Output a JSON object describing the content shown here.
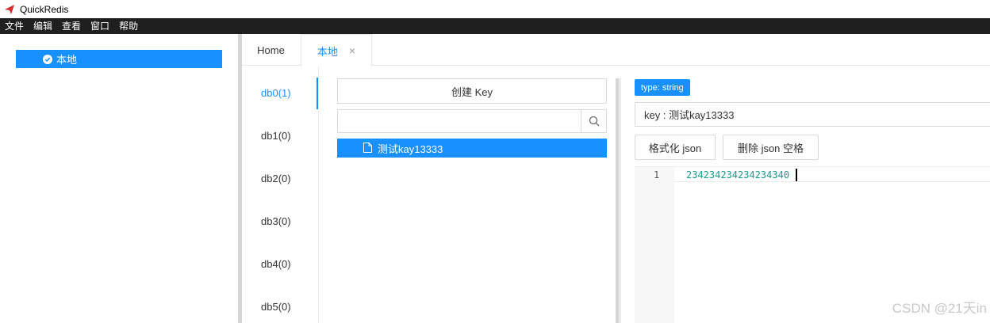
{
  "window": {
    "title": "QuickRedis"
  },
  "menu": [
    "文件",
    "编辑",
    "查看",
    "窗口",
    "帮助"
  ],
  "tree": {
    "connection_label": "本地"
  },
  "tabs": {
    "home": "Home",
    "local": "本地",
    "close": "×"
  },
  "databases": [
    "db0(1)",
    "db1(0)",
    "db2(0)",
    "db3(0)",
    "db4(0)",
    "db5(0)"
  ],
  "keys_panel": {
    "create_key_label": "创建 Key",
    "search_value": "",
    "keys": [
      "测试kay13333"
    ]
  },
  "value_panel": {
    "type_badge": "type: string",
    "key_field": "key : 测试kay13333",
    "format_button": "格式化 json",
    "remove_spaces_button": "删除 json 空格",
    "editor": {
      "line_number": "1",
      "content": "234234234234234340"
    }
  },
  "watermark": "CSDN @21天in",
  "colors": {
    "accent": "#1890ff",
    "menubar": "#1f1f1f",
    "code": "#1a9a8a"
  }
}
